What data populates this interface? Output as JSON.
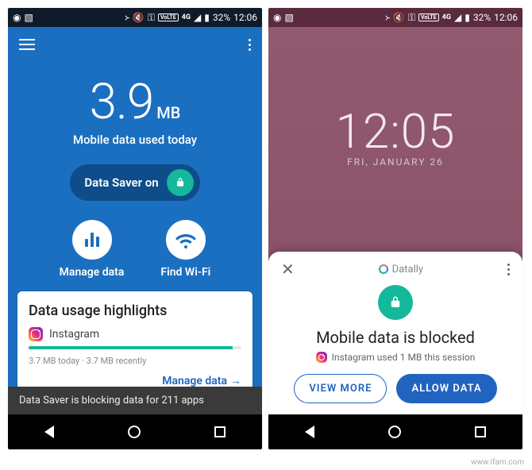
{
  "statusbar": {
    "battery": "32%",
    "time": "12:06",
    "volte": "VoLTE",
    "signal": "4G"
  },
  "main": {
    "usage_value": "3.9",
    "usage_unit": "MB",
    "usage_label": "Mobile data used today",
    "saver_pill": "Data Saver on",
    "manage_label": "Manage data",
    "wifi_label": "Find Wi-Fi",
    "card": {
      "title": "Data usage highlights",
      "app_name": "Instagram",
      "meta": "3.7 MB today  ·  3.7 MB recently",
      "link": "Manage data"
    },
    "toast": "Data Saver is blocking data for 211 apps"
  },
  "lock": {
    "clock": "12:05",
    "date": "FRI, JANUARY 26"
  },
  "sheet": {
    "brand": "Datally",
    "title": "Mobile data is blocked",
    "session": "Instagram used 1 MB this session",
    "view_more": "VIEW MORE",
    "allow": "ALLOW DATA"
  },
  "watermark": "www.ifam.com"
}
